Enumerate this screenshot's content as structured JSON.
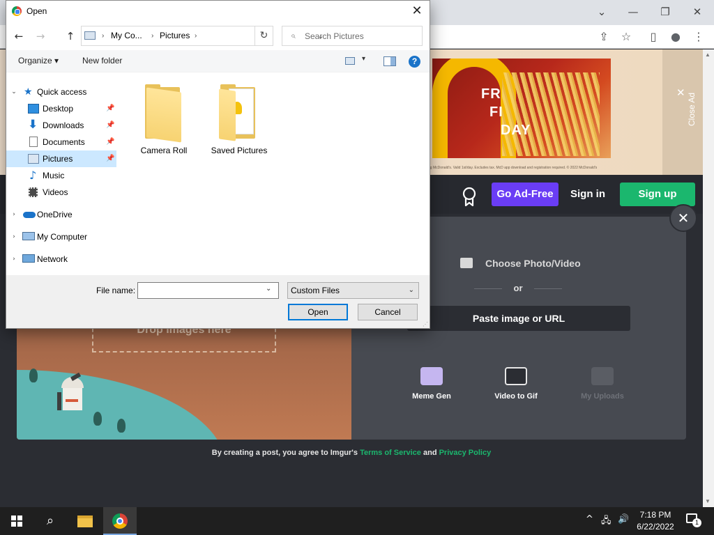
{
  "browser": {
    "window_controls": {
      "minimize": "—",
      "restore": "❐",
      "close": "✕",
      "tab_search": "⌄"
    },
    "toolbar_icons": {
      "share": "⇪",
      "bookmark": "☆",
      "sidebar": "▯",
      "profile": "●",
      "menu": "⋮"
    }
  },
  "ad": {
    "headline_lines": [
      "FR",
      "FI",
      "DAY"
    ],
    "fine_print": "ng McDonald's. Valid 1st/day. Excludes tax. McD app download and registration required. © 2022 McDonald's",
    "close_label": "Close Ad",
    "close_icon": "✕"
  },
  "imgur": {
    "go_adfree": "Go Ad-Free",
    "sign_in": "Sign in",
    "sign_up": "Sign up",
    "close_icon": "✕",
    "drop_images": "Drop images here",
    "choose_photo": "Choose Photo/Video",
    "or": "or",
    "paste_url": "Paste image or URL",
    "tools": [
      {
        "label": "Meme Gen",
        "icon": "meme-icon"
      },
      {
        "label": "Video to Gif",
        "icon": "video-camera-icon"
      },
      {
        "label": "My Uploads",
        "icon": "uploads-icon"
      }
    ],
    "terms": {
      "prefix": "By creating a post, you agree to Imgur's ",
      "terms_link": "Terms of Service",
      "and": " and ",
      "privacy_link": "Privacy Policy"
    },
    "colors": {
      "adfree": "#6a3df5",
      "signup": "#1bb76e",
      "link": "#1bb76e"
    }
  },
  "dialog": {
    "title": "Open",
    "close_icon": "✕",
    "nav": {
      "back": "←",
      "forward": "→",
      "up": "↑",
      "refresh": "↻"
    },
    "address": {
      "crumbs": [
        "My Co...",
        "Pictures"
      ],
      "separator": "›",
      "dropdown": "⌄"
    },
    "search": {
      "placeholder": "Search Pictures",
      "value": ""
    },
    "commands": {
      "organize": "Organize ▾",
      "new_folder": "New folder",
      "help": "?",
      "view_menu": "▾"
    },
    "nav_pane": {
      "quick_access": "Quick access",
      "items": [
        {
          "label": "Desktop",
          "pinned": "📌"
        },
        {
          "label": "Downloads",
          "pinned": "📌"
        },
        {
          "label": "Documents",
          "pinned": "📌"
        },
        {
          "label": "Pictures",
          "pinned": "📌",
          "selected": true
        },
        {
          "label": "Music"
        },
        {
          "label": "Videos"
        }
      ],
      "onedrive": "OneDrive",
      "my_computer": "My Computer",
      "network": "Network",
      "chev_open": "⌄",
      "chev_closed": "›"
    },
    "files": [
      {
        "name": "Camera Roll",
        "icon": "folder-icon"
      },
      {
        "name": "Saved Pictures",
        "icon": "folder-with-images-icon"
      }
    ],
    "file_name_label": "File name:",
    "file_name_value": "",
    "filter": "Custom Files",
    "open_button": "Open",
    "cancel_button": "Cancel",
    "dropdown_glyph": "⌄"
  },
  "taskbar": {
    "search_icon": "⌕",
    "time": "7:18 PM",
    "date": "6/22/2022",
    "notification_count": "1",
    "tray": {
      "chevron": "^",
      "network": "🖧",
      "volume": "🔊"
    }
  }
}
